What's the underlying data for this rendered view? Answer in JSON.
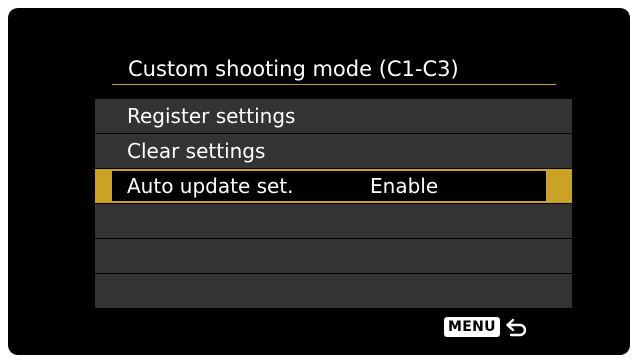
{
  "title": "Custom shooting mode (C1-C3)",
  "colors": {
    "accent": "#c9a227",
    "row_bg": "#333333",
    "screen_bg": "#000000",
    "text": "#ffffff"
  },
  "menu": {
    "items": [
      {
        "label": "Register settings",
        "value": ""
      },
      {
        "label": "Clear settings",
        "value": ""
      },
      {
        "label": "Auto update set.",
        "value": "Enable",
        "selected": true
      },
      {
        "label": "",
        "value": ""
      },
      {
        "label": "",
        "value": ""
      },
      {
        "label": "",
        "value": ""
      }
    ]
  },
  "footer": {
    "menu_key_label": "MENU",
    "return_icon": "return-arrow-icon"
  }
}
